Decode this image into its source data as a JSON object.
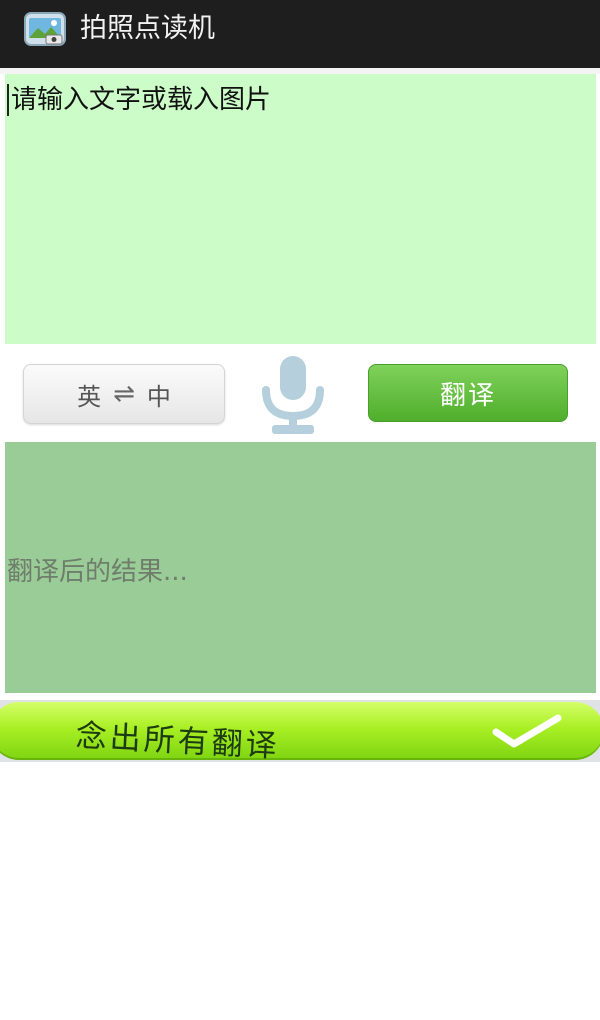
{
  "titlebar": {
    "title": "拍照点读机",
    "icon": "photo-app-icon"
  },
  "input": {
    "placeholder": "请输入文字或载入图片"
  },
  "controls": {
    "source_language": "英",
    "swap_symbol": "⇌",
    "target_language": "中",
    "mic_icon": "microphone-icon",
    "translate_label": "翻译"
  },
  "result": {
    "placeholder": "翻译后的结果..."
  },
  "read_all": {
    "label": "念出所有翻译",
    "icon": "check-icon"
  },
  "colors": {
    "titlebar_bg": "#1e1e1e",
    "input_bg": "#ccfcc8",
    "result_bg": "#9acc98",
    "translate_button": "#5cb536",
    "read_all_button": "#a9ef24",
    "mic": "#b5cfdc"
  }
}
